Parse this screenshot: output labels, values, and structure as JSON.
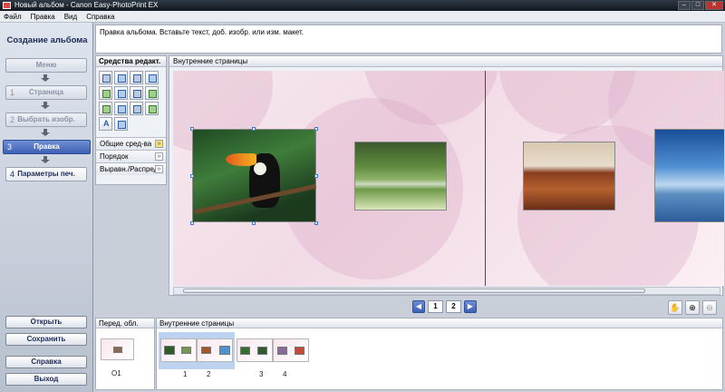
{
  "window": {
    "title": "Новый альбом - Canon Easy-PhotoPrint EX"
  },
  "menu": {
    "items": [
      "Файл",
      "Правка",
      "Вид",
      "Справка"
    ]
  },
  "sidebar": {
    "title": "Создание альбома",
    "steps": [
      {
        "num": "",
        "label": "Меню"
      },
      {
        "num": "1",
        "label": "Страница"
      },
      {
        "num": "2",
        "label": "Выбрать изобр."
      },
      {
        "num": "3",
        "label": "Правка"
      },
      {
        "num": "4",
        "label": "Параметры печ."
      }
    ],
    "buttons": {
      "open": "Открыть",
      "save": "Сохранить",
      "help": "Справка",
      "exit": "Выход"
    }
  },
  "hint": "Правка альбома. Вставьте текст, доб. изобр. или изм. макет.",
  "tools": {
    "header": "Средства редакт.",
    "sections": [
      "Общие сред-ва",
      "Порядок",
      "Выравн./Распред."
    ]
  },
  "editor": {
    "header": "Внутренние страницы"
  },
  "pager": {
    "pages": [
      "1",
      "2"
    ]
  },
  "bottom": {
    "cover_header": "Перед. обл.",
    "cover_label": "О1",
    "inner_header": "Внутренние страницы",
    "page_labels": [
      "1",
      "2",
      "3",
      "4"
    ]
  },
  "colors": {
    "accent": "#3e61b5",
    "selection": "#3a7bd5"
  }
}
